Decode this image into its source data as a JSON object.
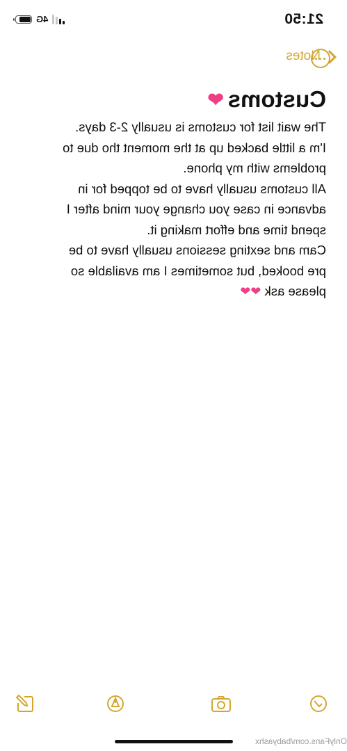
{
  "status_bar": {
    "time": "21:50",
    "network": "4G"
  },
  "nav": {
    "back_label": "Notes"
  },
  "note": {
    "title": "Customs",
    "lines": [
      "The wait list for customs is usually 2-3 days.",
      "I'm a little backed up at the moment tho due to",
      "problems with my phone.",
      "All customs usually have to be topped for in",
      "advance in case you change your mind after I",
      "spend time and effort making it.",
      "Cam and sexting sessions usually have to be",
      "pre booked, but sometimes I am available so",
      "please ask"
    ]
  },
  "watermark": "OnlyFans.com/babyashx",
  "colors": {
    "accent": "#d4a72c",
    "heart": "#ec3f86"
  }
}
